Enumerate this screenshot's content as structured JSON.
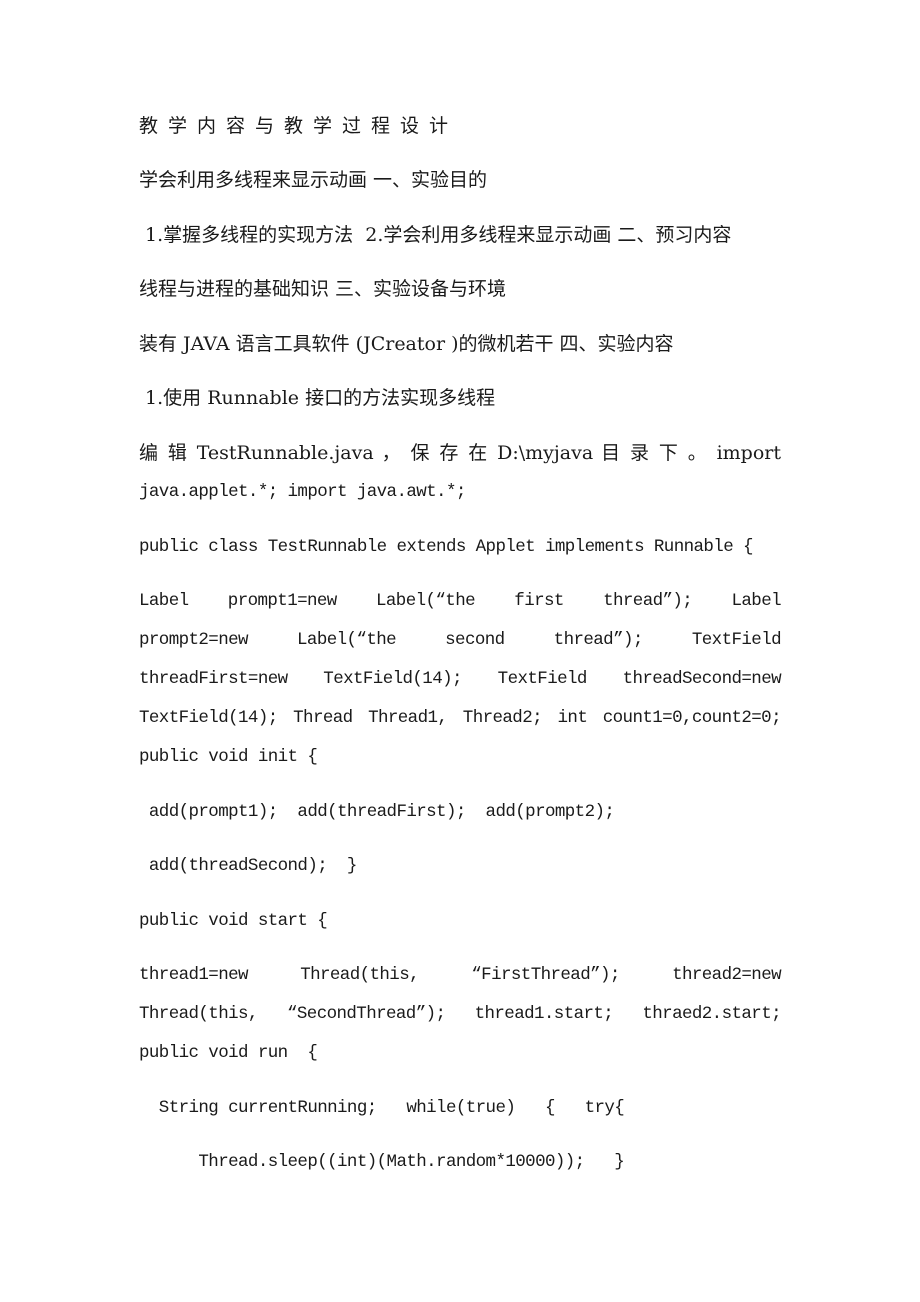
{
  "document": {
    "title": "教学内容与教学过程设计",
    "lines": [
      "学会利用多线程来显示动画 一、实验目的",
      " 1.掌握多线程的实现方法  2.学会利用多线程来显示动画 二、预习内容",
      "线程与进程的基础知识 三、实验设备与环境",
      "装有 JAVA 语言工具软件 (JCreator )的微机若干 四、实验内容",
      " 1.使用 Runnable 接口的方法实现多线程",
      "编 辑 TestRunnable.java ， 保 存 在 D:\\myjava 目 录 下 。  import",
      "java.applet.*; import java.awt.*;",
      "public class TestRunnable extends Applet implements Runnable {",
      " Label  prompt1=new  Label(“the  first  thread”);   Label",
      "prompt2=new  Label(“the  second  thread”);   TextField",
      "threadFirst=new  TextField(14);   TextField  threadSecond=new",
      "TextField(14); Thread Thread1, Thread2; int count1=0,count2=0;",
      "public void init {",
      " add(prompt1);  add(threadFirst);  add(prompt2);",
      " add(threadSecond);  }",
      "public void start {",
      " thread1=new  Thread(this,  “FirstThread”);    thread2=new",
      "Thread(this, “SecondThread”);  thread1.start;  thraed2.start;",
      "public void run  {",
      "  String currentRunning;   while(true)   {   try{",
      "      Thread.sleep((int)(Math.random*10000));   }"
    ]
  }
}
